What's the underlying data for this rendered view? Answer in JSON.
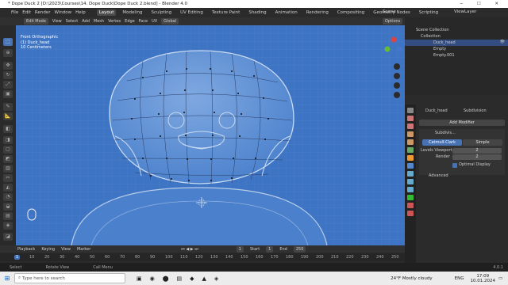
{
  "window": {
    "title": "* Dope Duck 2 [D:\\2023\\Courses\\14. Dope Duck\\Dope Duck 2.blend] - Blender 4.0",
    "controls": "─ ☐ ✕"
  },
  "menu": {
    "items": [
      "File",
      "Edit",
      "Render",
      "Window",
      "Help"
    ],
    "workspaces": [
      "Layout",
      "Modeling",
      "Sculpting",
      "UV Editing",
      "Texture Paint",
      "Shading",
      "Animation",
      "Rendering",
      "Compositing",
      "Geometry Nodes",
      "Scripting"
    ],
    "active_workspace": "Layout",
    "scene": "Scene",
    "view_layer": "ViewLayer"
  },
  "header": {
    "mode": "Edit Mode",
    "menus": [
      "View",
      "Select",
      "Add",
      "Mesh",
      "Vertex",
      "Edge",
      "Face",
      "UV"
    ],
    "orientation": "Global",
    "options": "Options"
  },
  "viewport": {
    "overlay_line1": "Front Orthographic",
    "overlay_line2": "(1) Duck_head",
    "overlay_line3": "10 Centimeters",
    "bg_color": "#3d74c4"
  },
  "outliner": {
    "root": "Scene Collection",
    "collection": "Collection",
    "objects": [
      {
        "name": "Duck_head",
        "selected": true
      },
      {
        "name": "Empty",
        "selected": false
      },
      {
        "name": "Empty.001",
        "selected": false
      }
    ]
  },
  "properties": {
    "object_name": "Duck_head",
    "modifier_type": "Subdivision",
    "add_modifier": "Add Modifier",
    "modifier_name": "Subdivis...",
    "catmull": "Catmull-Clark",
    "simple": "Simple",
    "levels_viewport_label": "Levels Viewport",
    "levels_viewport": "2",
    "render_label": "Render",
    "render": "2",
    "optimal_display": "Optimal Display",
    "advanced": "Advanced"
  },
  "timeline": {
    "menus": [
      "Playback",
      "Keying",
      "View",
      "Marker"
    ],
    "current_frame": "1",
    "start_label": "Start",
    "start": "1",
    "end_label": "End",
    "end": "250",
    "ticks": [
      "1",
      "10",
      "20",
      "30",
      "40",
      "50",
      "60",
      "70",
      "80",
      "90",
      "100",
      "110",
      "120",
      "130",
      "140",
      "150",
      "160",
      "170",
      "180",
      "190",
      "200",
      "210",
      "220",
      "230",
      "240",
      "250"
    ]
  },
  "status": {
    "select": "Select",
    "rotate": "Rotate View",
    "call_menu": "Call Menu",
    "version": "4.0.1"
  },
  "taskbar": {
    "search_placeholder": "Type here to search",
    "weather": "24°F  Mostly cloudy",
    "lang": "ENG",
    "time": "17:09",
    "date": "10.01.2024"
  }
}
